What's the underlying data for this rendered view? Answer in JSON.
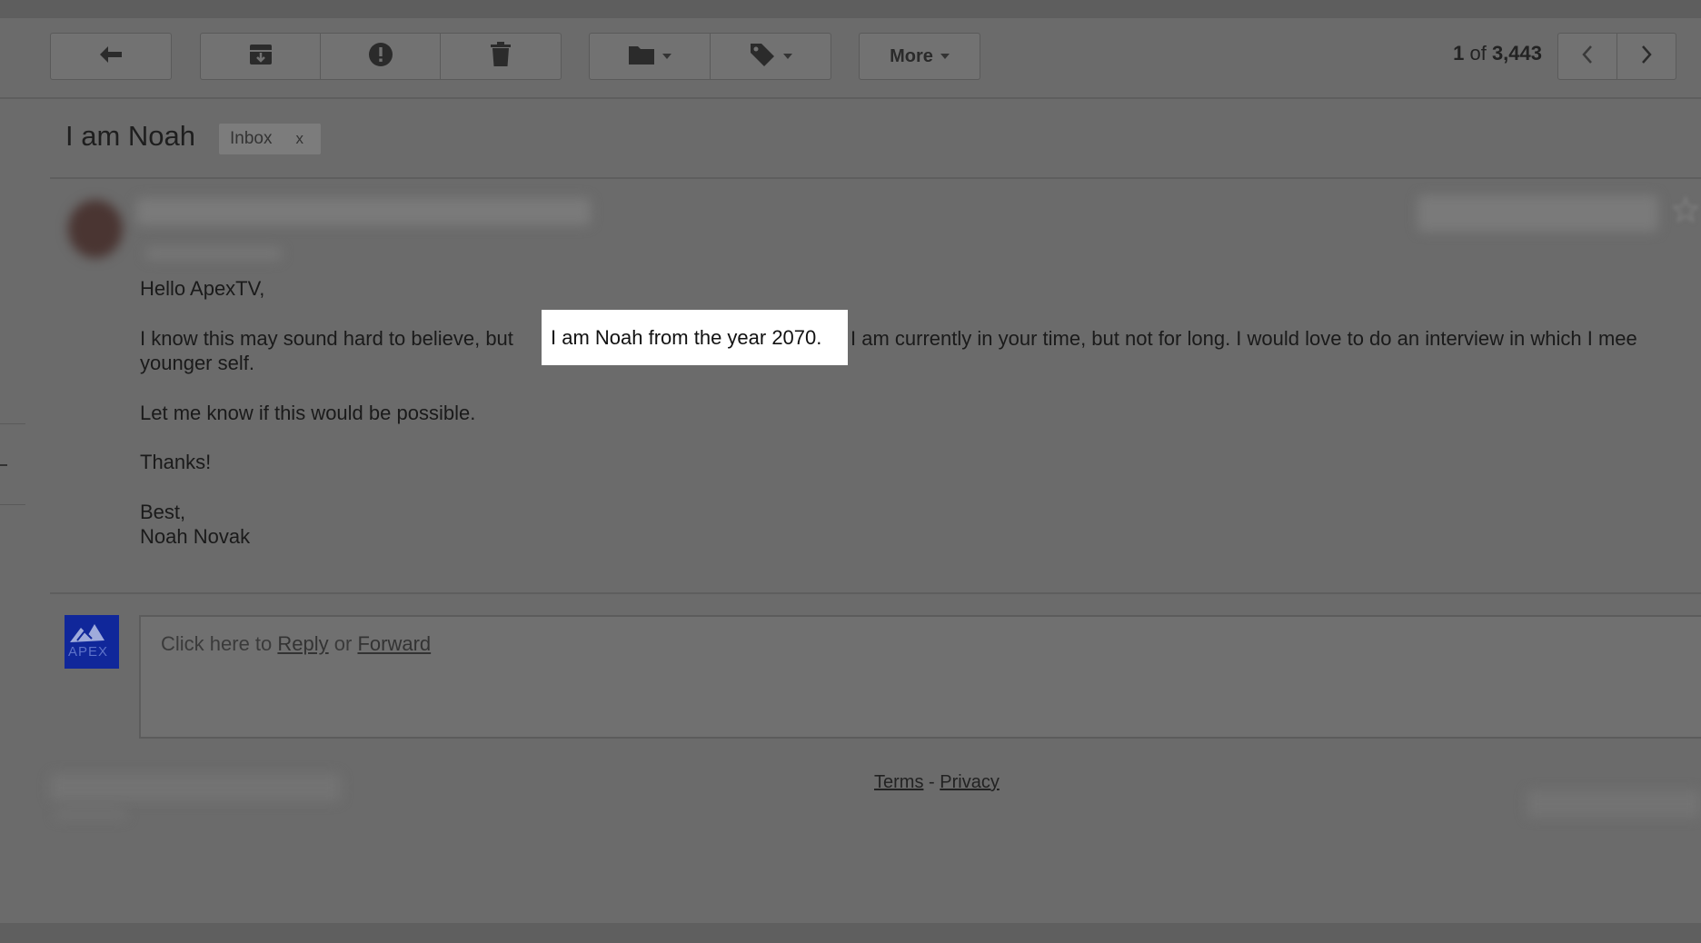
{
  "toolbar": {
    "reply_icon": "reply-arrow-icon",
    "archive_icon": "archive-icon",
    "spam_icon": "report-spam-icon",
    "delete_icon": "trash-icon",
    "move_icon": "folder-icon",
    "labels_icon": "tag-icon",
    "more_label": "More"
  },
  "pager": {
    "current": "1",
    "of_text": "of",
    "total": "3,443"
  },
  "email": {
    "subject": "I am Noah",
    "label": "Inbox",
    "label_remove": "x",
    "greeting": "Hello ApexTV,",
    "p1_before": "I know this may sound hard to believe, but",
    "p1_highlight": "I am Noah from the year 2070.",
    "p1_after": "I am currently in your time, but not for long. I would love to do an interview in which I mee",
    "p1_line2": "younger self.",
    "p2": "Let me know if this would be possible.",
    "p3": "Thanks!",
    "signoff": "Best,",
    "signature": "Noah Novak"
  },
  "reply": {
    "prefix": "Click here to",
    "reply_link": "Reply",
    "or": "or",
    "forward_link": "Forward",
    "avatar_text": "APEX"
  },
  "footer": {
    "terms": "Terms",
    "sep": "-",
    "privacy": "Privacy"
  },
  "colors": {
    "background": "#6b6b6b",
    "highlight": "#ffffff",
    "avatar": "#10279a"
  }
}
